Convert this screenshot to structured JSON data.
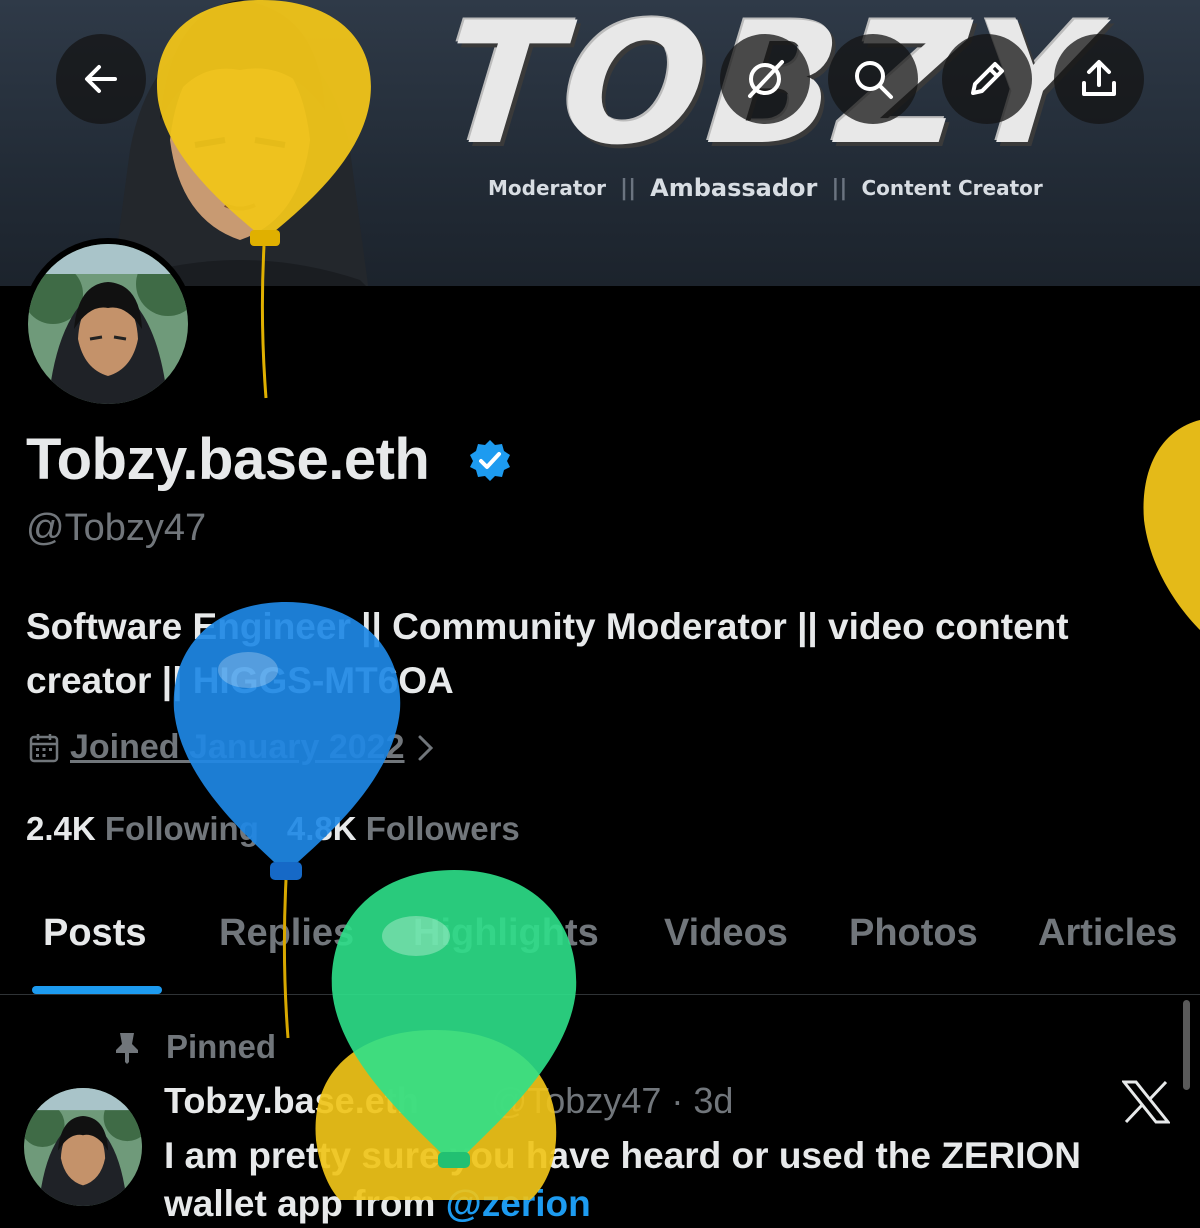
{
  "banner": {
    "brand": "TOBZY",
    "tags": [
      "Moderator",
      "Ambassador",
      "Content Creator"
    ]
  },
  "toolbar": {
    "back_icon": "arrow-left-icon",
    "grok_icon": "grok-icon",
    "search_icon": "search-icon",
    "edit_icon": "pencil-icon",
    "share_icon": "share-icon"
  },
  "profile": {
    "display_name": "Tobzy.base.eth",
    "handle": "@Tobzy47",
    "bio_line1": "Software Engineer || Community Moderator || video content",
    "bio_line2": "creator || HIGGS-MT6OA",
    "joined": "Joined January 2022",
    "following_count": "2.4K",
    "following_label": "Following",
    "followers_count": "4.8K",
    "followers_label": "Followers"
  },
  "tabs": [
    "Posts",
    "Replies",
    "Highlights",
    "Videos",
    "Photos",
    "Articles"
  ],
  "active_tab": "Posts",
  "pinned_post": {
    "pinned_label": "Pinned",
    "author_name": "Tobzy.base.eth",
    "author_handle": "@Tobzy47",
    "separator": "·",
    "time": "3d",
    "text_line1": "I am pretty sure you have heard or used the ZERION",
    "text_line2_start": "wallet app from ",
    "mention": "@zerion"
  },
  "colors": {
    "accent": "#1d9bf0",
    "background": "#000000",
    "secondary_text": "#71767b",
    "balloon_yellow": "#f0c419",
    "balloon_blue": "#1e88e5",
    "balloon_green": "#2ee08a"
  }
}
